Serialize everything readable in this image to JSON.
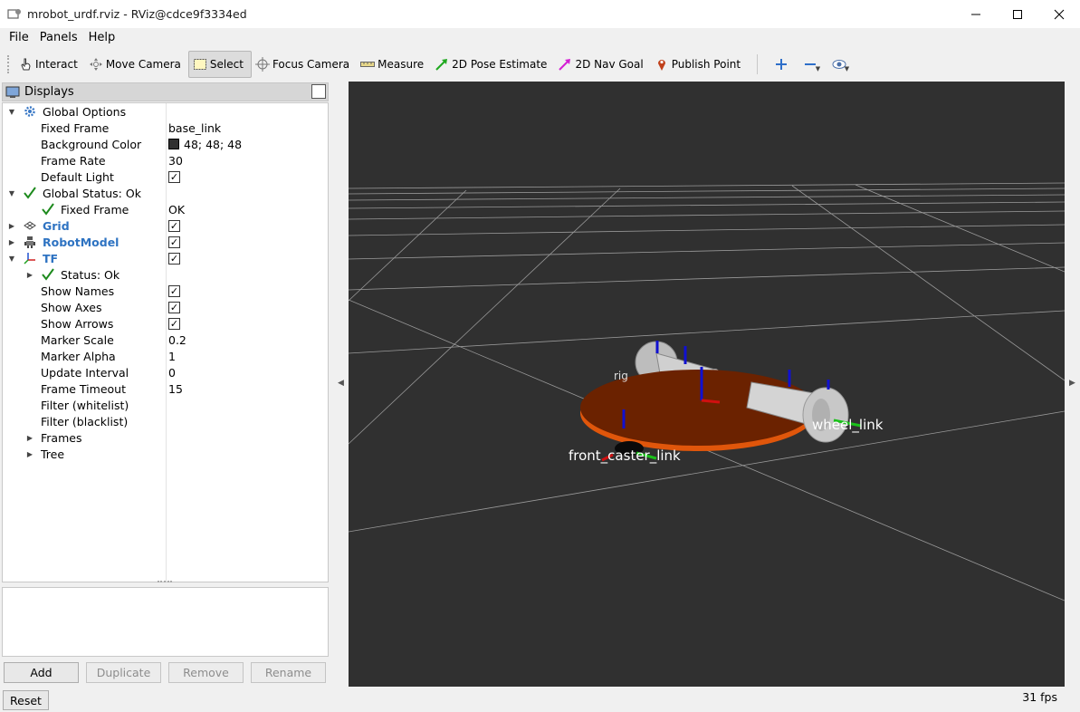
{
  "window": {
    "title": "mrobot_urdf.rviz - RViz@cdce9f3334ed"
  },
  "menu": {
    "file": "File",
    "panels": "Panels",
    "help": "Help"
  },
  "toolbar": {
    "interact": "Interact",
    "move_camera": "Move Camera",
    "select": "Select",
    "focus_camera": "Focus Camera",
    "measure": "Measure",
    "pose_estimate": "2D Pose Estimate",
    "nav_goal": "2D Nav Goal",
    "publish_point": "Publish Point"
  },
  "displays": {
    "title": "Displays",
    "rows": [
      {
        "name": "Global Options",
        "value": ""
      },
      {
        "name": "Fixed Frame",
        "value": "base_link"
      },
      {
        "name": "Background Color",
        "value": "48; 48; 48"
      },
      {
        "name": "Frame Rate",
        "value": "30"
      },
      {
        "name": "Default Light",
        "value": ""
      },
      {
        "name": "Global Status: Ok",
        "value": ""
      },
      {
        "name": "Fixed Frame",
        "value": "OK"
      },
      {
        "name": "Grid",
        "value": ""
      },
      {
        "name": "RobotModel",
        "value": ""
      },
      {
        "name": "TF",
        "value": ""
      },
      {
        "name": "Status: Ok",
        "value": ""
      },
      {
        "name": "Show Names",
        "value": ""
      },
      {
        "name": "Show Axes",
        "value": ""
      },
      {
        "name": "Show Arrows",
        "value": ""
      },
      {
        "name": "Marker Scale",
        "value": "0.2"
      },
      {
        "name": "Marker Alpha",
        "value": "1"
      },
      {
        "name": "Update Interval",
        "value": "0"
      },
      {
        "name": "Frame Timeout",
        "value": "15"
      },
      {
        "name": "Filter (whitelist)",
        "value": ""
      },
      {
        "name": "Filter (blacklist)",
        "value": ""
      },
      {
        "name": "Frames",
        "value": ""
      },
      {
        "name": "Tree",
        "value": ""
      }
    ],
    "background_color_hex": "#303030"
  },
  "buttons": {
    "add": "Add",
    "duplicate": "Duplicate",
    "remove": "Remove",
    "rename": "Rename",
    "reset": "Reset"
  },
  "view": {
    "labels": {
      "front_caster": "front_caster_link",
      "wheel_right": "wheel_link",
      "partial_left": "rig"
    },
    "fps": "31 fps",
    "colors": {
      "base_plate": "#6b2200",
      "base_rim": "#e0560b",
      "wheel": "#c8c8c8",
      "axis_z": "#1010d0",
      "axis_y": "#19c019",
      "axis_x": "#d01010"
    }
  }
}
